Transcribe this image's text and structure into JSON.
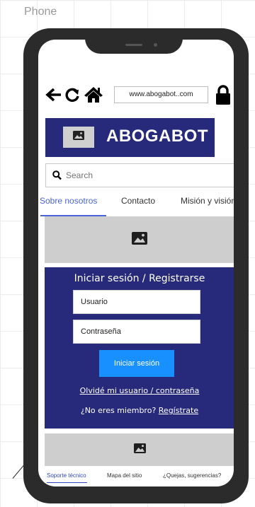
{
  "canvas": {
    "label": "Phone"
  },
  "browser": {
    "url": "www.abogabot..com",
    "icons": [
      "arrow-left-icon",
      "refresh-icon",
      "home-icon",
      "lock-icon"
    ]
  },
  "header": {
    "brand_name": "ABOGABOT",
    "logo_icon": "image-icon"
  },
  "search": {
    "placeholder": "Search",
    "icon": "search-icon"
  },
  "tabs": [
    {
      "label": "Sobre nosotros",
      "active": true
    },
    {
      "label": "Contacto",
      "active": false
    },
    {
      "label": "Misión y visión",
      "active": false
    }
  ],
  "hero": {
    "icon": "image-icon"
  },
  "login": {
    "title": "Iniciar sesión / Registrarse",
    "username_placeholder": "Usuario",
    "password_placeholder": "Contraseña",
    "submit_label": "Iniciar sesión",
    "forgot_label": "Olvidé mi usuario / contraseña",
    "not_member_prefix": "¿No eres miembro? ",
    "signup_label": "Regístrate"
  },
  "footer_banner": {
    "icon": "image-icon"
  },
  "footer_links": [
    {
      "label": "Soporte técnico",
      "active": true
    },
    {
      "label": "Mapa del sitio",
      "active": false
    },
    {
      "label": "¿Quejas, sugerencias?",
      "active": false
    }
  ],
  "colors": {
    "phone_frame": "#2b2b2b",
    "brand_navy": "#27297a",
    "accent_blue": "#1890ff",
    "tab_active": "#4a63d6",
    "placeholder_gray": "#cecece"
  }
}
